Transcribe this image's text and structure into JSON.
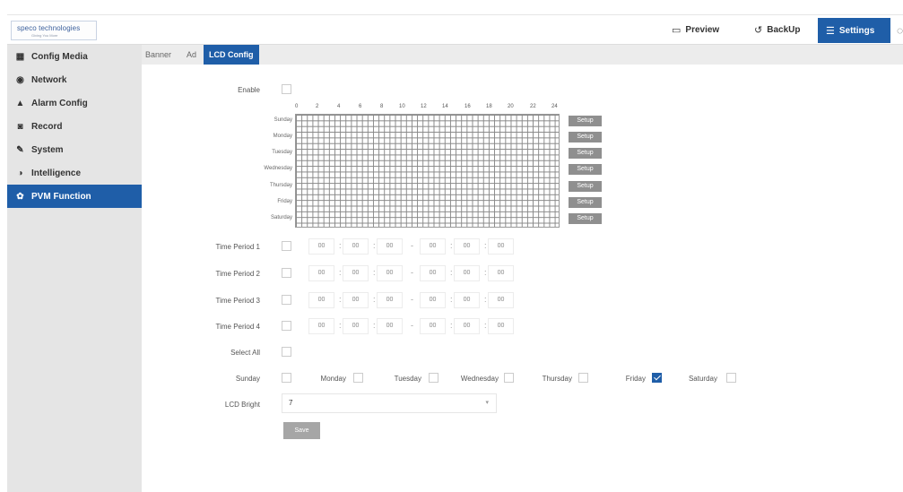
{
  "header": {
    "logo_text": "speco technologies",
    "logo_tagline": "Giving You More",
    "preview_label": "Preview",
    "backup_label": "BackUp",
    "settings_label": "Settings",
    "accent_color": "#1f5ea8"
  },
  "sidebar": {
    "items": [
      {
        "label": "Config Media",
        "icon": "media-icon"
      },
      {
        "label": "Network",
        "icon": "network-icon"
      },
      {
        "label": "Alarm Config",
        "icon": "alarm-icon"
      },
      {
        "label": "Record",
        "icon": "record-icon"
      },
      {
        "label": "System",
        "icon": "wrench-icon"
      },
      {
        "label": "Intelligence",
        "icon": "intelligence-icon"
      },
      {
        "label": "PVM Function",
        "icon": "gear-icon",
        "active": true
      }
    ]
  },
  "tabs": [
    {
      "label": "Banner"
    },
    {
      "label": "Ad"
    },
    {
      "label": "LCD Config",
      "active": true
    }
  ],
  "form": {
    "enable_label": "Enable",
    "enable_checked": false,
    "schedule": {
      "hours": [
        "0",
        "2",
        "4",
        "6",
        "8",
        "10",
        "12",
        "14",
        "16",
        "18",
        "20",
        "22",
        "24"
      ],
      "days": [
        "Sunday",
        "Monday",
        "Tuesday",
        "Wednesday",
        "Thursday",
        "Friday",
        "Saturday"
      ],
      "setup_label": "Setup"
    },
    "time_periods": [
      {
        "label": "Time Period 1",
        "start": [
          "00",
          "00",
          "00"
        ],
        "end": [
          "00",
          "00",
          "00"
        ]
      },
      {
        "label": "Time Period 2",
        "start": [
          "00",
          "00",
          "00"
        ],
        "end": [
          "00",
          "00",
          "00"
        ]
      },
      {
        "label": "Time Period 3",
        "start": [
          "00",
          "00",
          "00"
        ],
        "end": [
          "00",
          "00",
          "00"
        ]
      },
      {
        "label": "Time Period 4",
        "start": [
          "00",
          "00",
          "00"
        ],
        "end": [
          "00",
          "00",
          "00"
        ]
      }
    ],
    "time_sep": ":",
    "range_sep": "-",
    "select_all_label": "Select All",
    "weekdays": [
      {
        "label": "Sunday",
        "checked": false
      },
      {
        "label": "Monday",
        "checked": false
      },
      {
        "label": "Tuesday",
        "checked": false
      },
      {
        "label": "Wednesday",
        "checked": false
      },
      {
        "label": "Thursday",
        "checked": false
      },
      {
        "label": "Friday",
        "checked": true
      },
      {
        "label": "Saturday",
        "checked": false
      }
    ],
    "lcd_bright_label": "LCD Bright",
    "lcd_bright_value": "7",
    "save_label": "Save"
  }
}
